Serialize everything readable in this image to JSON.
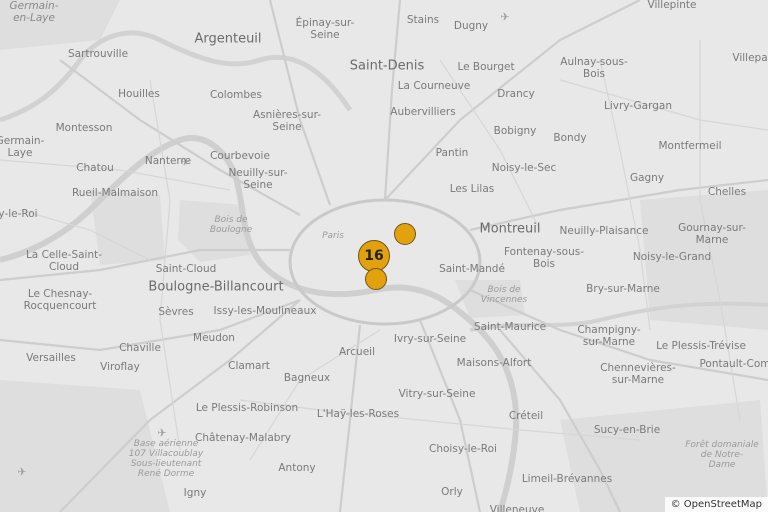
{
  "map": {
    "attribution": "© OpenStreetMap",
    "colors": {
      "marker": "#e1a20e",
      "marker_border": "#6e5420",
      "land": "#e8e8e8",
      "water": "#d3d3d3"
    },
    "cluster": {
      "count": "16"
    },
    "markers": [
      {
        "name": "marker-1"
      },
      {
        "name": "marker-2"
      }
    ],
    "labels": {
      "germain_en_laye": "Germain-\nen-Laye",
      "villepinte": "Villepinte",
      "villepa": "Villepa",
      "argenteuil": "Argenteuil",
      "epinay": "Épinay-sur-\nSeine",
      "stains": "Stains",
      "dugny": "Dugny",
      "sartrouville": "Sartrouville",
      "saint_denis": "Saint-Denis",
      "le_bourget": "Le Bourget",
      "aulnay": "Aulnay-sous-\nBois",
      "houilles": "Houilles",
      "colombes": "Colombes",
      "la_courneuve": "La Courneuve",
      "drancy": "Drancy",
      "livry_gargan": "Livry-Gargan",
      "asnieres": "Asnières-sur-\nSeine",
      "aubervilliers": "Aubervilliers",
      "montesson": "Montesson",
      "germain_laye_left": "Germain-\nLaye",
      "bobigny": "Bobigny",
      "bondy": "Bondy",
      "montfermeil": "Montfermeil",
      "chatou": "Chatou",
      "nanterre": "Nanterre",
      "courbevoie": "Courbevoie",
      "pantin": "Pantin",
      "noisy_le_sec": "Noisy-le-Sec",
      "gagny": "Gagny",
      "rueil": "Rueil-Malmaison",
      "neuilly_seine": "Neuilly-sur-\nSeine",
      "les_lilas": "Les Lilas",
      "chelles": "Chelles",
      "y_le_roi": "y-le-Roi",
      "bois_boulogne": "Bois de\nBoulogne",
      "montreuil": "Montreuil",
      "neuilly_plaisance": "Neuilly-Plaisance",
      "gournay": "Gournay-sur-\nMarne",
      "paris": "Paris",
      "la_celle": "La Celle-Saint-\nCloud",
      "fontenay": "Fontenay-sous-\nBois",
      "noisy_le_grand": "Noisy-le-Grand",
      "saint_cloud": "Saint-Cloud",
      "saint_mande": "Saint-Mandé",
      "le_chesnay": "Le Chesnay-\nRocquencourt",
      "boulogne": "Boulogne-Billancourt",
      "bois_vincennes": "Bois de\nVincennes",
      "bry": "Bry-sur-Marne",
      "sevres": "Sèvres",
      "issy": "Issy-les-Moulineaux",
      "saint_maurice": "Saint-Maurice",
      "champigny": "Champigny-\nsur-Marne",
      "meudon": "Meudon",
      "ivry": "Ivry-sur-Seine",
      "le_plessis_trevise": "Le Plessis-Trévise",
      "versailles": "Versailles",
      "chaville": "Chaville",
      "arcueil": "Arcueil",
      "maisons_alfort": "Maisons-Alfort",
      "pontault": "Pontault-Com",
      "viroflay": "Viroflay",
      "clamart": "Clamart",
      "chennevieres": "Chennevières-\nsur-Marne",
      "bagneux": "Bagneux",
      "vitry": "Vitry-sur-Seine",
      "le_plessis_robinson": "Le Plessis-Robinson",
      "l_hay": "L'Haÿ-les-Roses",
      "creteil": "Créteil",
      "base_aerienne": "Base aérienne\n107 Villacoublay\nSous-lieutenant\nRené Dorme",
      "chatenay": "Châtenay-Malabry",
      "sucy": "Sucy-en-Brie",
      "choisy": "Choisy-le-Roi",
      "foret_notre_dame": "Forêt domaniale\nde Notre-\nDame",
      "antony": "Antony",
      "limeil": "Limeil-Brévannes",
      "igny": "Igny",
      "orly": "Orly",
      "villeneuve": "Villeneuve"
    }
  }
}
